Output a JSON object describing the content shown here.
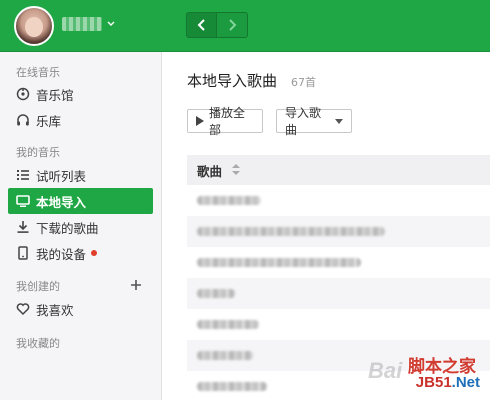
{
  "header": {
    "username": "●●●●● ▾",
    "back_glyph": "‹",
    "forward_glyph": "›",
    "back_icon": "chevron-left-icon",
    "forward_icon": "chevron-right-icon",
    "accent": "#1fa745"
  },
  "sidebar": {
    "sections": [
      {
        "title": "在线音乐"
      },
      {
        "title": "我的音乐"
      },
      {
        "title": "我创建的"
      },
      {
        "title": "我收藏的"
      }
    ],
    "items": [
      {
        "label": "音乐馆",
        "icon": "disc-icon"
      },
      {
        "label": "乐库",
        "icon": "headphones-icon"
      },
      {
        "label": "试听列表",
        "icon": "list-icon"
      },
      {
        "label": "本地导入",
        "icon": "monitor-icon",
        "active": true
      },
      {
        "label": "下载的歌曲",
        "icon": "download-icon"
      },
      {
        "label": "我的设备",
        "icon": "device-icon",
        "badge_color": "#e0402a"
      },
      {
        "label": "我喜欢",
        "icon": "heart-icon"
      }
    ],
    "add_icon": "plus-icon"
  },
  "main": {
    "title": "本地导入歌曲",
    "count": "67首",
    "play_all_label": "播放全部",
    "import_label": "导入歌曲",
    "column_header": "歌曲",
    "songs": [
      "▒▒▒▒▒▒▒▒▒",
      "▒ ▒ ▒ ▒▒▒▒▒▒▒▒▒▒▒▒▒▒▒▒▒",
      "▒▒▒▒▒▒▒▒▒▒▒▒▒▒▒▒▒▒▒▒▒▒",
      "▒▒▒▒▒▒",
      "▒▒▒▒▒▒▒▒▒",
      "▒▒▒▒▒▒▒▒",
      "▒▒▒▒▒▒▒▒▒▒"
    ]
  },
  "watermark": {
    "line1": "脚本之家",
    "line2_a": "JB51",
    "line2_b": ".Net",
    "faint": "Bai"
  }
}
